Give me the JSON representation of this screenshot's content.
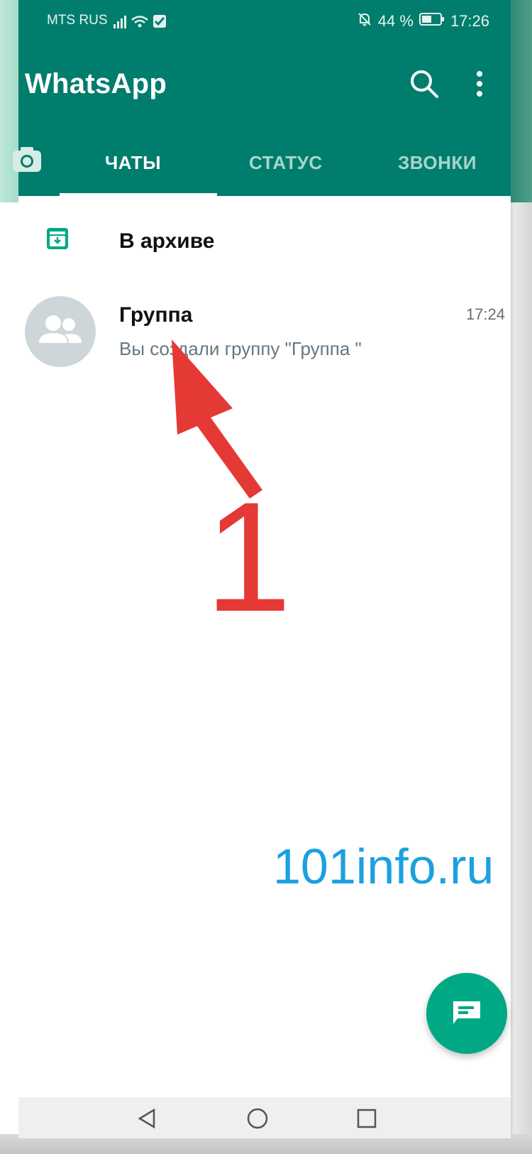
{
  "status_bar": {
    "carrier": "MTS RUS",
    "battery": "44 %",
    "time": "17:26"
  },
  "header": {
    "title": "WhatsApp",
    "search_icon": "search-icon",
    "menu_icon": "more-vertical-icon"
  },
  "tabs": [
    {
      "label": "ЧАТЫ",
      "active": true
    },
    {
      "label": "СТАТУС",
      "active": false
    },
    {
      "label": "ЗВОНКИ",
      "active": false
    }
  ],
  "archive": {
    "label": "В архиве",
    "icon": "archive-icon"
  },
  "chats": [
    {
      "name": "Группа",
      "time": "17:24",
      "preview": "Вы создали группу \"Группа \"",
      "avatar_icon": "group-icon"
    }
  ],
  "annotation": {
    "number": "1",
    "color": "#e53935"
  },
  "watermark": "101info.ru",
  "fab": {
    "icon": "new-chat-icon"
  },
  "nav": [
    "back-icon",
    "home-icon",
    "recents-icon"
  ],
  "colors": {
    "primary": "#017d6d",
    "accent": "#00a884",
    "watermark": "#1ca0e0"
  }
}
